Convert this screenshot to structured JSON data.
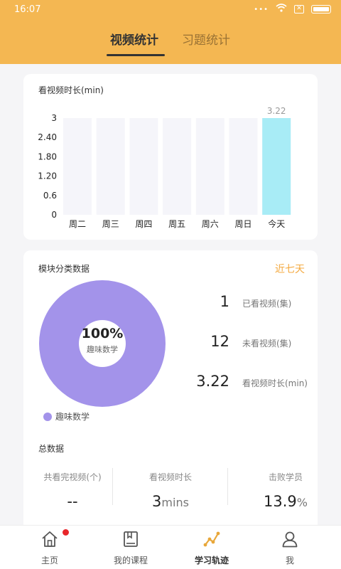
{
  "status": {
    "time": "16:07",
    "dots": "•••"
  },
  "tabs": [
    {
      "label": "视频统计",
      "active": true
    },
    {
      "label": "习题统计",
      "active": false
    }
  ],
  "video_card": {
    "title": "看视频时长(min)"
  },
  "chart_data": {
    "type": "bar",
    "title": "看视频时长(min)",
    "categories": [
      "周二",
      "周三",
      "周四",
      "周五",
      "周六",
      "周日",
      "今天"
    ],
    "values": [
      0,
      0,
      0,
      0,
      0,
      0,
      3.22
    ],
    "data_labels": [
      "",
      "",
      "",
      "",
      "",
      "",
      "3.22"
    ],
    "y_ticks": [
      "3",
      "2.40",
      "1.80",
      "1.20",
      "0.6",
      "0"
    ],
    "ylim": [
      0,
      3
    ],
    "colors": {
      "bar": "#a8ecf6",
      "track": "#f5f5fa"
    }
  },
  "module_card": {
    "title": "模块分类数据",
    "range_label": "近七天",
    "donut": {
      "percent": "100%",
      "name": "趣味数学",
      "color": "#a393ea"
    },
    "legend": "趣味数学",
    "stats": [
      {
        "value": "1",
        "label": "已看视频(集)"
      },
      {
        "value": "12",
        "label": "未看视频(集)"
      },
      {
        "value": "3.22",
        "label": "看视频时长(min)"
      }
    ]
  },
  "totals": {
    "title": "总数据",
    "items": [
      {
        "label": "共看完视频(个)",
        "value": "--",
        "unit": ""
      },
      {
        "label": "看视频时长",
        "value": "3",
        "unit": "mins"
      },
      {
        "label": "击败学员",
        "value": "13.9",
        "unit": "%"
      }
    ]
  },
  "nav": [
    {
      "label": "主页",
      "icon": "home-icon",
      "badge": true,
      "active": false
    },
    {
      "label": "我的课程",
      "icon": "book-icon",
      "badge": false,
      "active": false
    },
    {
      "label": "学习轨迹",
      "icon": "track-icon",
      "badge": false,
      "active": true
    },
    {
      "label": "我",
      "icon": "user-icon",
      "badge": false,
      "active": false
    }
  ],
  "theme": {
    "accent": "#f4b752",
    "orange_text": "#f4a93f"
  }
}
